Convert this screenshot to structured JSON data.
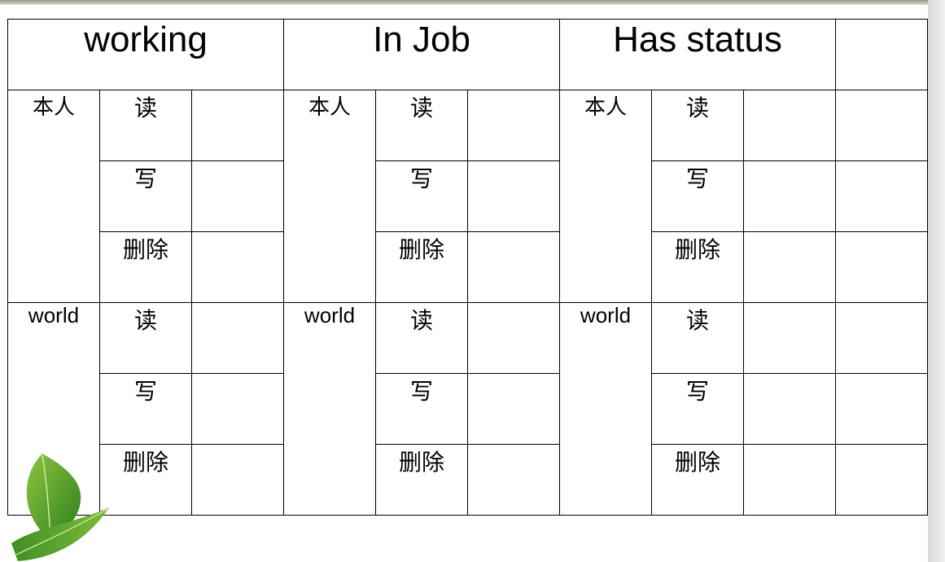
{
  "columns": [
    {
      "title": "working",
      "roles": [
        {
          "name": "本人",
          "perms": [
            "读",
            "写",
            "删除"
          ]
        },
        {
          "name": "world",
          "perms": [
            "读",
            "写",
            "删除"
          ]
        }
      ]
    },
    {
      "title": "In Job",
      "roles": [
        {
          "name": "本人",
          "perms": [
            "读",
            "写",
            "删除"
          ]
        },
        {
          "name": "world",
          "perms": [
            "读",
            "写",
            "删除"
          ]
        }
      ]
    },
    {
      "title": "Has status",
      "roles": [
        {
          "name": "本人",
          "perms": [
            "读",
            "写",
            "删除"
          ]
        },
        {
          "name": "world",
          "perms": [
            "读",
            "写",
            "删除"
          ]
        }
      ]
    }
  ],
  "decoration": {
    "leaf": "green-leaf-icon"
  }
}
